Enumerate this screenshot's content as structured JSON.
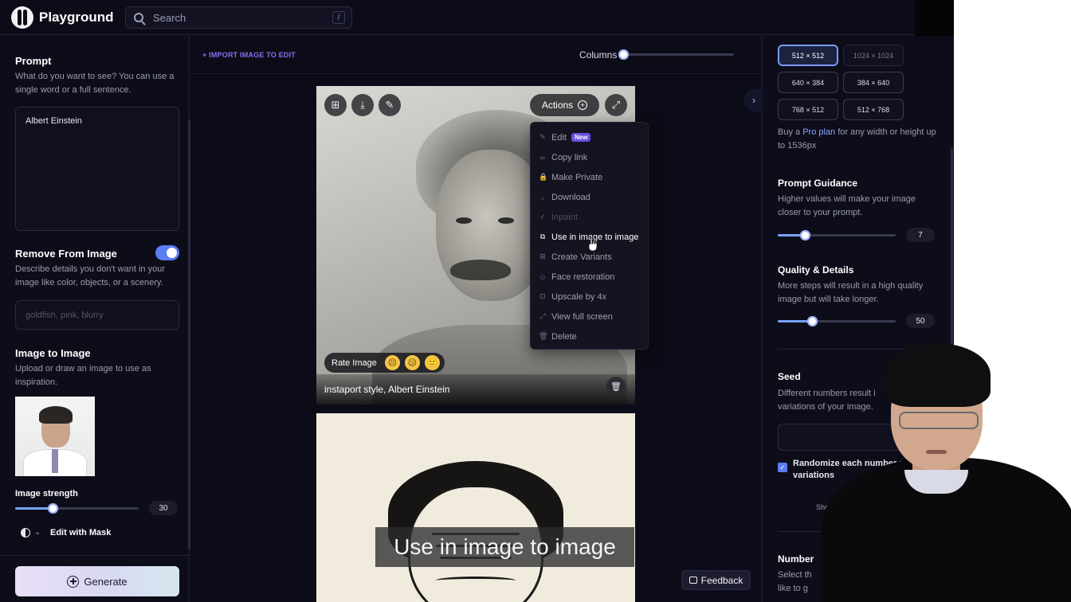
{
  "app": {
    "name": "Playground"
  },
  "search": {
    "placeholder": "Search",
    "shortcut": "/"
  },
  "left": {
    "prompt_title": "Prompt",
    "prompt_desc": "What do you want to see? You can use a single word or a full sentence.",
    "prompt_value": "Albert Einstein",
    "remove_title": "Remove From Image",
    "remove_toggle_on": true,
    "remove_desc": "Describe details you don't want in your image like color, objects, or a scenery.",
    "remove_placeholder": "goldfish, pink, blurry",
    "i2i_title": "Image to Image",
    "i2i_desc": "Upload or draw an image to use as inspiration.",
    "strength_label": "Image strength",
    "strength_value": "30",
    "strength_fraction": 0.3,
    "mask_label": "Edit with Mask",
    "generate_label": "Generate"
  },
  "center": {
    "import_link": "+ IMPORT IMAGE TO EDIT",
    "columns_label": "Columns",
    "columns_fraction": 0.0,
    "actions_label": "Actions",
    "rate_label": "Rate Image",
    "emojis": [
      "😣",
      "😕",
      "🙂"
    ],
    "caption": "instaport style, Albert Einstein",
    "menu": [
      {
        "label": "Edit",
        "icon": "✎",
        "badge": "New",
        "state": "normal"
      },
      {
        "label": "Copy link",
        "icon": "∞",
        "state": "normal"
      },
      {
        "label": "Make Private",
        "icon": "🔒",
        "state": "normal"
      },
      {
        "label": "Download",
        "icon": "↓",
        "state": "normal"
      },
      {
        "label": "Inpaint",
        "icon": "✓",
        "state": "disabled"
      },
      {
        "label": "Use in image to image",
        "icon": "⧉",
        "state": "active"
      },
      {
        "label": "Create Variants",
        "icon": "⊞",
        "state": "normal"
      },
      {
        "label": "Face restoration",
        "icon": "☺",
        "state": "normal"
      },
      {
        "label": "Upscale by 4x",
        "icon": "⊡",
        "state": "normal"
      },
      {
        "label": "View full screen",
        "icon": "⤢",
        "state": "normal"
      },
      {
        "label": "Delete",
        "icon": "🗑",
        "state": "normal"
      }
    ],
    "subtitle": "Use in image to image",
    "feedback_label": "Feedback"
  },
  "right": {
    "sizes": [
      {
        "label": "512 × 512",
        "state": "selected"
      },
      {
        "label": "1024 × 1024",
        "state": "muted"
      },
      {
        "label": "640 × 384",
        "state": "normal"
      },
      {
        "label": "384 × 640",
        "state": "normal"
      },
      {
        "label": "768 × 512",
        "state": "normal"
      },
      {
        "label": "512 × 768",
        "state": "normal"
      }
    ],
    "pro_text_before": "Buy a ",
    "pro_link": "Pro plan",
    "pro_text_after": " for any width or height up to 1536px",
    "guidance_title": "Prompt Guidance",
    "guidance_desc": "Higher values will make your image closer to your prompt.",
    "guidance_value": "7",
    "guidance_fraction": 0.23,
    "quality_title": "Quality & Details",
    "quality_desc": "More steps will result in a high quality image but will take longer.",
    "quality_value": "50",
    "quality_fraction": 0.29,
    "seed_title": "Seed",
    "seed_desc": "Different numbers result i variations of your image.",
    "randomize_label": "Randomize each number new variations",
    "show_text": "Sho",
    "number_title": "Number",
    "number_desc": "Select th like to g"
  }
}
